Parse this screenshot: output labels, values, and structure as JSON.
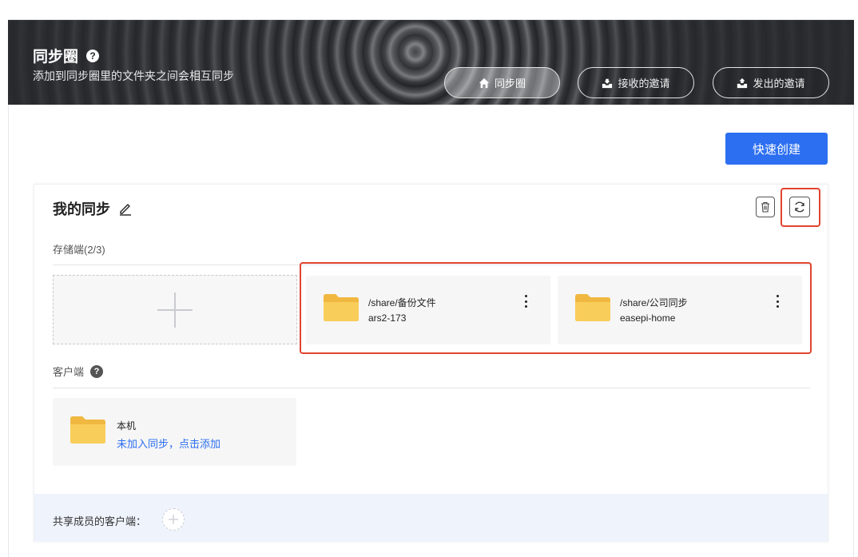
{
  "header": {
    "title": "同步圈",
    "help_glyph": "?",
    "subtitle": "添加到同步圈里的文件夹之间会相互同步",
    "nav": [
      {
        "label": "同步圈",
        "icon": "home-icon",
        "active": true
      },
      {
        "label": "接收的邀请",
        "icon": "inbox-download-icon",
        "active": false
      },
      {
        "label": "发出的邀请",
        "icon": "inbox-upload-icon",
        "active": false
      }
    ]
  },
  "toolbar": {
    "quick_create_label": "快速创建"
  },
  "sync_group": {
    "title": "我的同步",
    "storage_label": "存储端(2/3)",
    "storage": [
      {
        "path": "/share/备份文件",
        "device": "ars2-173"
      },
      {
        "path": "/share/公司同步",
        "device": "easepi-home"
      }
    ],
    "client_label": "客户端",
    "client": {
      "name": "本机",
      "action_link": "未加入同步，点击添加"
    },
    "members_label": "共享成员的客户端："
  },
  "colors": {
    "accent": "#2c6ff1",
    "highlight": "#e0442f",
    "folder": "#f7c64a",
    "members_bg": "#eef3fc"
  }
}
